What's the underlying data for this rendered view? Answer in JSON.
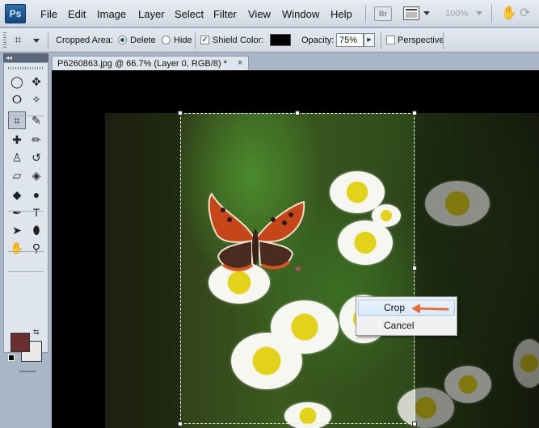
{
  "app": {
    "logo": "Ps"
  },
  "menu": [
    "File",
    "Edit",
    "Image",
    "Layer",
    "Select",
    "Filter",
    "View",
    "Window",
    "Help"
  ],
  "appbar": {
    "bridge": "Br",
    "zoom": "100%"
  },
  "options": {
    "cropped_area_label": "Cropped Area:",
    "delete_label": "Delete",
    "hide_label": "Hide",
    "shield_label": "Shield",
    "color_label": "Color:",
    "opacity_label": "Opacity:",
    "opacity_value": "75%",
    "perspective_label": "Perspective",
    "shield_checked": true,
    "perspective_checked": false,
    "shield_color": "#000000"
  },
  "document": {
    "tab_title": "P6260863.jpg @ 66.7% (Layer 0, RGB/8) *",
    "close": "×"
  },
  "toolbox": {
    "collapse": "◂◂",
    "foreground_color": "#6b2f2f",
    "background_color": "#e9e9e9",
    "tools": [
      {
        "name": "marquee-tool-icon",
        "glyph": "◯"
      },
      {
        "name": "move-tool-icon",
        "glyph": "✥"
      },
      {
        "name": "lasso-tool-icon",
        "glyph": "ⵔ"
      },
      {
        "name": "magic-wand-tool-icon",
        "glyph": "✧"
      },
      {
        "name": "crop-tool-icon",
        "glyph": "⌗"
      },
      {
        "name": "eyedropper-tool-icon",
        "glyph": "✎"
      },
      {
        "name": "healing-brush-tool-icon",
        "glyph": "✚"
      },
      {
        "name": "brush-tool-icon",
        "glyph": "✏"
      },
      {
        "name": "clone-stamp-tool-icon",
        "glyph": "♙"
      },
      {
        "name": "history-brush-tool-icon",
        "glyph": "↺"
      },
      {
        "name": "eraser-tool-icon",
        "glyph": "▱"
      },
      {
        "name": "paint-bucket-tool-icon",
        "glyph": "◈"
      },
      {
        "name": "blur-tool-icon",
        "glyph": "◆"
      },
      {
        "name": "dodge-tool-icon",
        "glyph": "●"
      },
      {
        "name": "pen-tool-icon",
        "glyph": "✒"
      },
      {
        "name": "type-tool-icon",
        "glyph": "T"
      },
      {
        "name": "path-selection-tool-icon",
        "glyph": "➤"
      },
      {
        "name": "shape-tool-icon",
        "glyph": "⬮"
      },
      {
        "name": "hand-tool-icon",
        "glyph": "✋"
      },
      {
        "name": "zoom-tool-icon",
        "glyph": "⚲"
      }
    ]
  },
  "context_menu": {
    "items": [
      "Crop",
      "Cancel"
    ],
    "highlighted": "Crop",
    "arrow_color": "#e86a3a"
  }
}
